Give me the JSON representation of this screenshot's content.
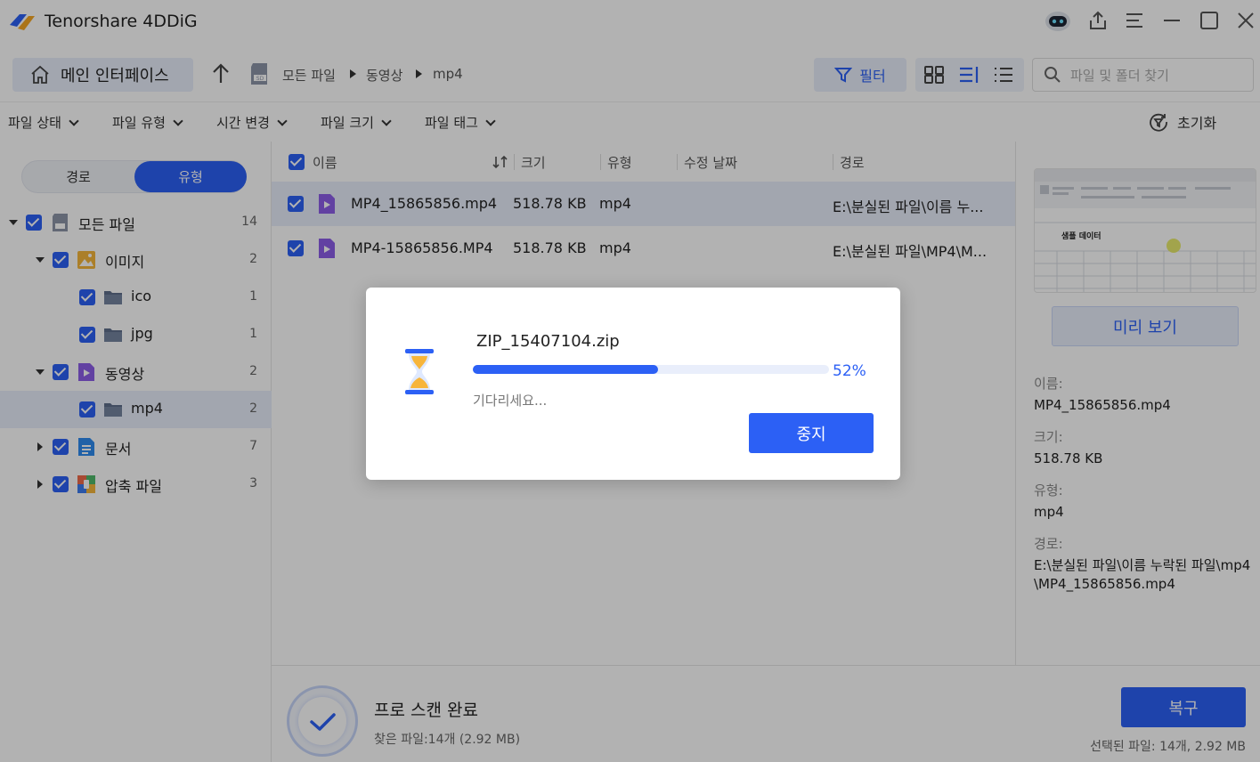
{
  "app": {
    "title": "Tenorshare 4DDiG"
  },
  "toolbar": {
    "home_label": "메인 인터페이스",
    "breadcrumb": [
      "모든 파일",
      "동영상",
      "mp4"
    ],
    "filter_label": "필터",
    "search_placeholder": "파일 및 폴더 찾기"
  },
  "filters": {
    "items": [
      "파일 상태",
      "파일 유형",
      "시간 변경",
      "파일 크기",
      "파일 태그"
    ],
    "reset_label": "초기화"
  },
  "left_panel": {
    "tabs": [
      "경로",
      "유형"
    ],
    "active_tab": "유형",
    "tree": [
      {
        "label": "모든 파일",
        "count": "14",
        "icon": "sd-card-icon"
      },
      {
        "label": "이미지",
        "count": "2",
        "icon": "image-icon"
      },
      {
        "label": "ico",
        "count": "1",
        "icon": "folder-icon"
      },
      {
        "label": "jpg",
        "count": "1",
        "icon": "folder-icon"
      },
      {
        "label": "동영상",
        "count": "2",
        "icon": "video-icon"
      },
      {
        "label": "mp4",
        "count": "2",
        "icon": "folder-icon"
      },
      {
        "label": "문서",
        "count": "7",
        "icon": "document-icon"
      },
      {
        "label": "압축 파일",
        "count": "3",
        "icon": "archive-icon"
      }
    ]
  },
  "file_list": {
    "columns": [
      "이름",
      "크기",
      "유형",
      "수정 날짜",
      "경로"
    ],
    "rows": [
      {
        "name": "MP4_15865856.mp4",
        "size": "518.78 KB",
        "type": "mp4",
        "date": "",
        "path": "E:\\분실된 파일\\이름 누..."
      },
      {
        "name": "MP4-15865856.MP4",
        "size": "518.78 KB",
        "type": "mp4",
        "date": "",
        "path": "E:\\분실된 파일\\MP4\\M..."
      }
    ]
  },
  "details": {
    "preview_label": "미리 보기",
    "name_label": "이름:",
    "name_value": "MP4_15865856.mp4",
    "size_label": "크기:",
    "size_value": "518.78 KB",
    "type_label": "유형:",
    "type_value": "mp4",
    "path_label": "경로:",
    "path_value": "E:\\분실된 파일\\이름 누락된 파일\\mp4\\MP4_15865856.mp4",
    "thumb_text": "샘플 데이터"
  },
  "bottom": {
    "scan_title": "프로 스캔 완료",
    "scan_sub": "찾은 파일:14개 (2.92 MB)",
    "recover_label": "복구",
    "selected_info": "선택된 파일: 14개, 2.92 MB"
  },
  "dialog": {
    "filename": "ZIP_15407104.zip",
    "progress": 0.52,
    "percent_text": "52%",
    "wait_text": "기다리세요...",
    "stop_label": "중지"
  },
  "colors": {
    "accent": "#2c60f5",
    "selection": "#e9eefb"
  }
}
